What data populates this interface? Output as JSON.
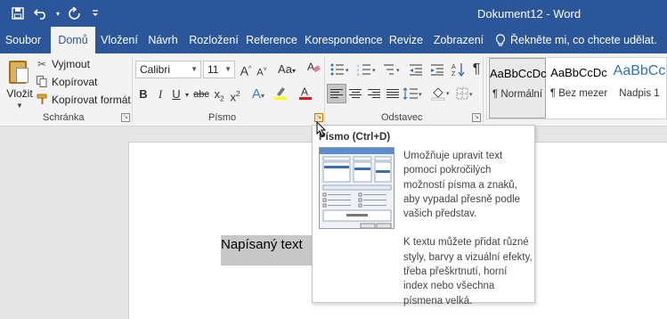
{
  "window": {
    "title": "Dokument12 - Word"
  },
  "quick_access": {
    "icons": [
      "save-icon",
      "undo-icon",
      "undo-dropdown-icon",
      "redo-icon",
      "customize-qat-icon"
    ]
  },
  "tabs": [
    {
      "label": "Soubor",
      "active": false
    },
    {
      "label": "Domů",
      "active": true
    },
    {
      "label": "Vložení",
      "active": false
    },
    {
      "label": "Návrh",
      "active": false
    },
    {
      "label": "Rozložení",
      "active": false
    },
    {
      "label": "Reference",
      "active": false
    },
    {
      "label": "Korespondence",
      "active": false
    },
    {
      "label": "Revize",
      "active": false
    },
    {
      "label": "Zobrazení",
      "active": false
    }
  ],
  "tell_me": {
    "text": "Řekněte mi, co chcete udělat."
  },
  "clipboard": {
    "paste_label": "Vložit",
    "cut_label": "Vyjmout",
    "copy_label": "Kopírovat",
    "format_painter_label": "Kopírovat formát",
    "group_label": "Schránka"
  },
  "font": {
    "font_name": "Calibri",
    "font_size": "11",
    "case_label": "Aa",
    "group_label": "Písmo"
  },
  "paragraph": {
    "group_label": "Odstavec"
  },
  "styles": {
    "items": [
      {
        "preview": "AaBbCcDc",
        "name": "¶ Normální",
        "selected": true
      },
      {
        "preview": "AaBbCcDc",
        "name": "¶ Bez mezer",
        "selected": false
      },
      {
        "preview": "AaBbCc",
        "name": "Nadpis 1",
        "selected": false
      }
    ]
  },
  "document": {
    "text": "Napísaný text"
  },
  "tooltip": {
    "title": "Písmo (Ctrl+D)",
    "paragraph1": "Umožňuje upravit text pomocí pokročilých možností písma a znaků, aby vypadal přesně podle vašich představ.",
    "paragraph2": "K textu můžete přidat různé styly, barvy a vizuální efekty, třeba přeškrtnutí, horní index nebo všechna písmena velká."
  },
  "colors": {
    "brand": "#2b579a",
    "ribbon": "#f3f3f3",
    "highlight_yellow": "#ffff00",
    "font_red": "#e81123"
  }
}
